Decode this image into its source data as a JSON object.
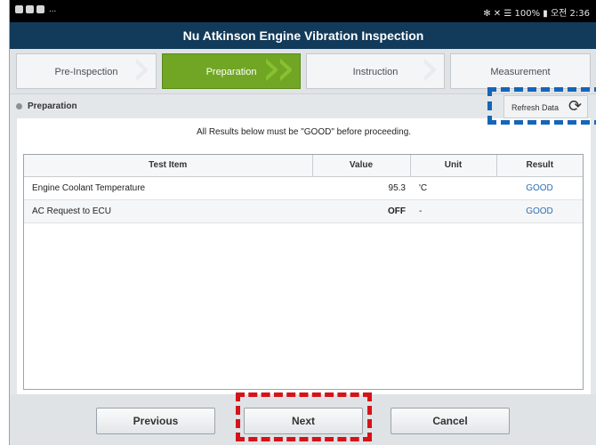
{
  "statusbar": {
    "overflow": "...",
    "right": "✻ ✕ ☰ 100% ▮ 오전 2:36"
  },
  "app": {
    "title": "Nu Atkinson Engine Vibration Inspection"
  },
  "steps": [
    {
      "label": "Pre-Inspection",
      "active": false
    },
    {
      "label": "Preparation",
      "active": true
    },
    {
      "label": "Instruction",
      "active": false
    },
    {
      "label": "Measurement",
      "active": false
    }
  ],
  "section": {
    "title": "Preparation",
    "refresh_label": "Refresh Data",
    "refresh_icon": "refresh-icon"
  },
  "notice": "All Results below must be \"GOOD\" before proceeding.",
  "table": {
    "headers": {
      "item": "Test Item",
      "value": "Value",
      "unit": "Unit",
      "result": "Result"
    },
    "rows": [
      {
        "item": "Engine Coolant Temperature",
        "value": "95.3",
        "unit": "'C",
        "result": "GOOD"
      },
      {
        "item": "AC Request to ECU",
        "value": "OFF",
        "unit": "-",
        "result": "GOOD"
      }
    ]
  },
  "buttons": {
    "previous": "Previous",
    "next": "Next",
    "cancel": "Cancel"
  },
  "colors": {
    "active_step": "#71a625",
    "title_bar": "#123a5a",
    "result_good": "#2f6fb5",
    "highlight_blue": "#1566b8",
    "highlight_red": "#d51318"
  }
}
